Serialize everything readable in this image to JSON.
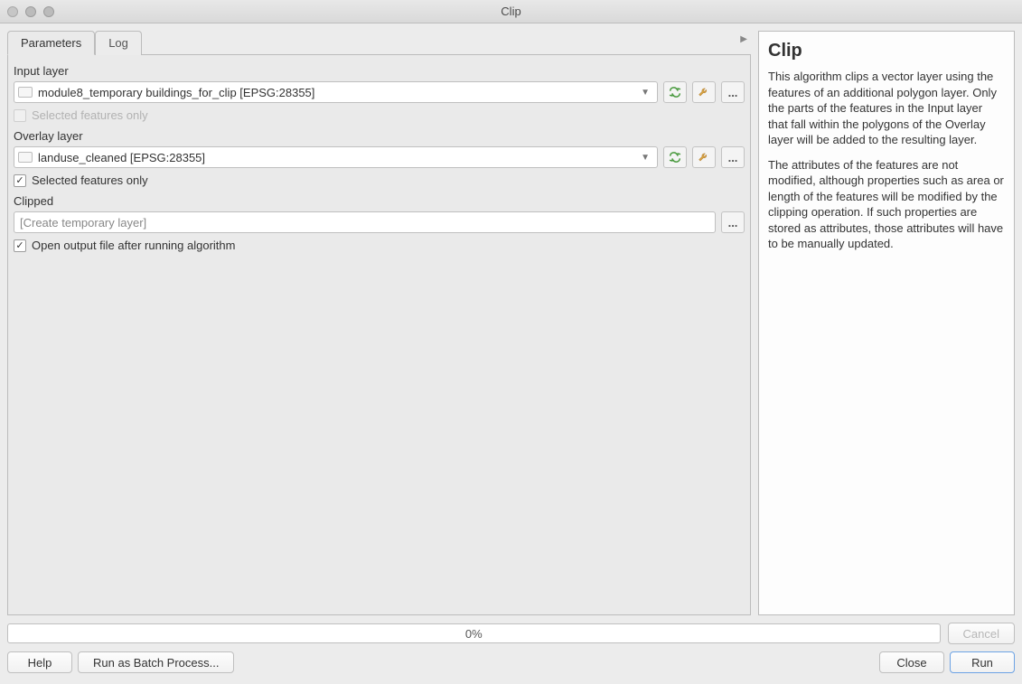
{
  "window": {
    "title": "Clip"
  },
  "tabs": {
    "parameters": "Parameters",
    "log": "Log"
  },
  "input_layer": {
    "label": "Input layer",
    "value": "module8_temporary buildings_for_clip [EPSG:28355]",
    "selected_only_label": "Selected features only",
    "selected_only_checked": false,
    "selected_only_enabled": false
  },
  "overlay_layer": {
    "label": "Overlay layer",
    "value": "landuse_cleaned [EPSG:28355]",
    "selected_only_label": "Selected features only",
    "selected_only_checked": true
  },
  "clipped": {
    "label": "Clipped",
    "placeholder": "[Create temporary layer]",
    "open_after_label": "Open output file after running algorithm",
    "open_after_checked": true
  },
  "help": {
    "title": "Clip",
    "p1": "This algorithm clips a vector layer using the features of an additional polygon layer. Only the parts of the features in the Input layer that fall within the polygons of the Overlay layer will be added to the resulting layer.",
    "p2": "The attributes of the features are not modified, although properties such as area or length of the features will be modified by the clipping operation. If such properties are stored as attributes, those attributes will have to be manually updated."
  },
  "progress": {
    "text": "0%"
  },
  "buttons": {
    "cancel": "Cancel",
    "help": "Help",
    "batch": "Run as Batch Process...",
    "close": "Close",
    "run": "Run"
  },
  "more": "..."
}
